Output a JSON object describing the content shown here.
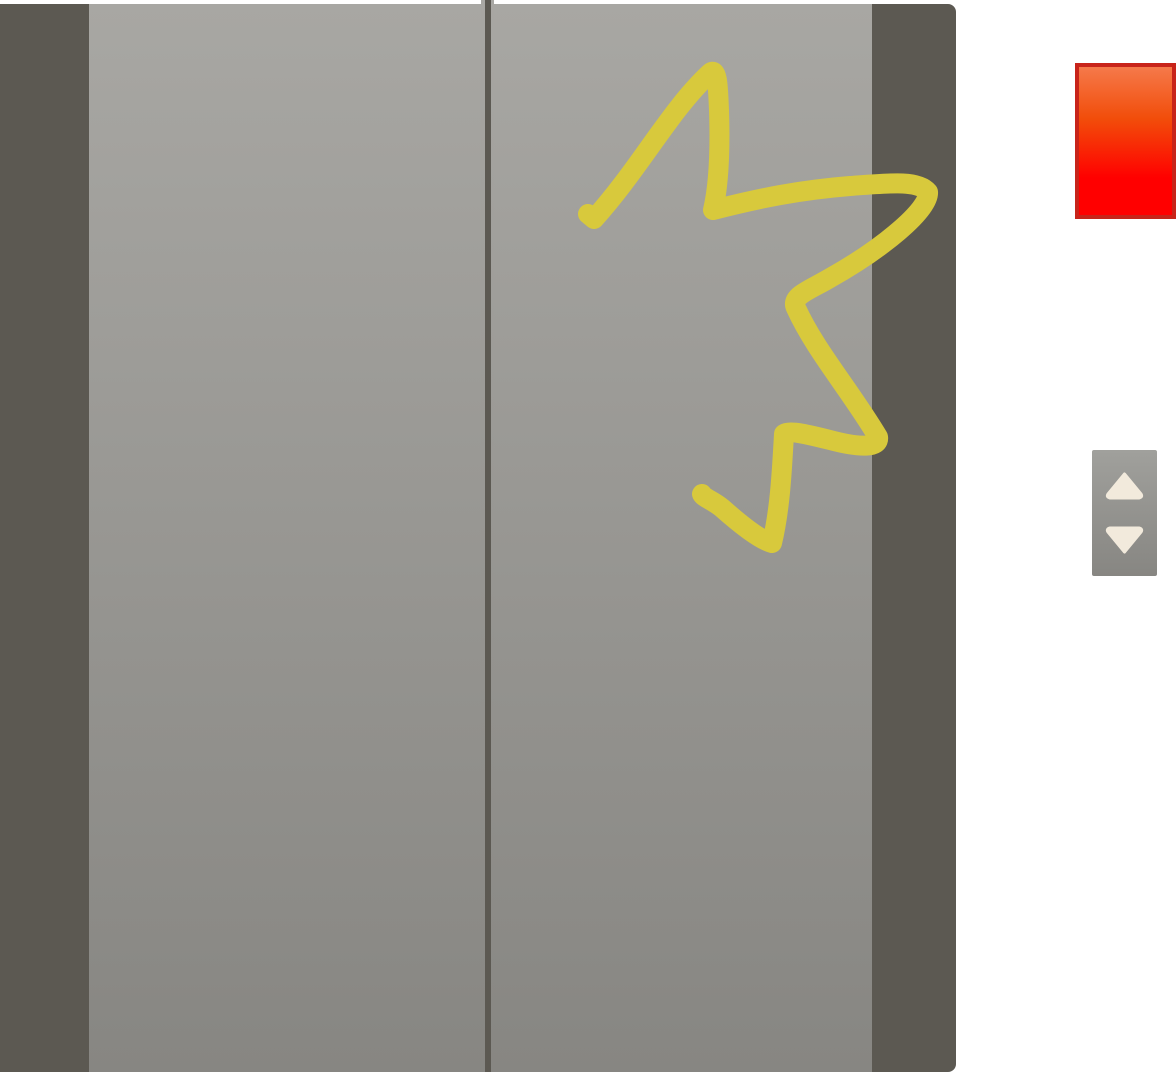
{
  "scene": {
    "name": "elevator",
    "colors": {
      "frame": "#5c5952",
      "door_top": "#a8a7a3",
      "door_bottom": "#878682",
      "seam": "#5c5952",
      "scribble": "#d8c93c",
      "alarm_top": "#f5794a",
      "alarm_mid": "#f24d0a",
      "alarm_bottom": "#ff0000",
      "alarm_border": "#c8241a",
      "control_panel_top": "#a0a09c",
      "control_panel_bottom": "#878682",
      "arrow_fill": "#f2eadc"
    }
  },
  "alarm_button": {
    "icon": "alarm-button"
  },
  "floor_control": {
    "up": {
      "icon": "triangle-up-icon"
    },
    "down": {
      "icon": "triangle-down-icon"
    }
  }
}
